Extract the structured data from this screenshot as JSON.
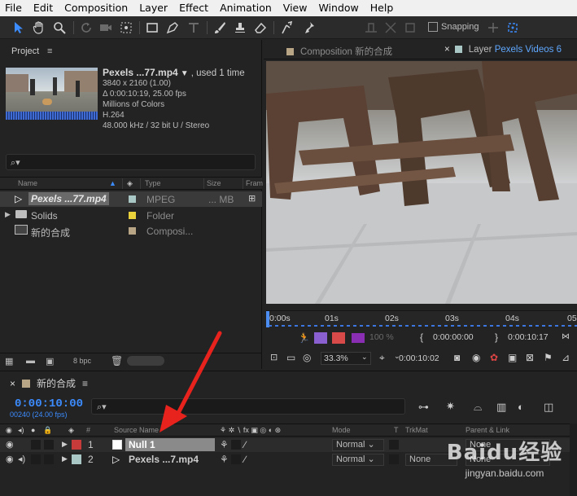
{
  "menu": [
    "File",
    "Edit",
    "Composition",
    "Layer",
    "Effect",
    "Animation",
    "View",
    "Window",
    "Help"
  ],
  "toolbar": {
    "snapping_label": "Snapping",
    "snapping_checked": false
  },
  "project": {
    "title": "Project",
    "menu_icon": "hamburger-icon",
    "file_name": "Pexels ...77.mp4",
    "used": ", used 1 time",
    "details": [
      "3840 x 2160 (1.00)",
      "Δ 0:00:10:19, 25.00 fps",
      "Millions of Colors",
      "H.264",
      "48.000 kHz / 32 bit U / Stereo"
    ],
    "search_placeholder": "",
    "columns": {
      "name": "Name",
      "type": "Type",
      "size": "Size",
      "frame": "Fram"
    },
    "items": [
      {
        "name": "Pexels ...77.mp4",
        "type": "MPEG",
        "size": "... MB",
        "label_color": "#a9c7c5",
        "icon": "footage-icon",
        "selected": true
      },
      {
        "name": "Solids",
        "type": "Folder",
        "size": "",
        "label_color": "#e8d13b",
        "icon": "folder-icon",
        "selected": false
      },
      {
        "name": "新的合成",
        "type": "Composi...",
        "size": "",
        "label_color": "#b8a586",
        "icon": "composition-icon",
        "selected": false
      }
    ],
    "bpc": "8 bpc"
  },
  "viewer": {
    "tab_composition": "Composition",
    "tab_composition_name": "新的合成",
    "tab_layer": "Layer",
    "tab_layer_name": "Pexels Videos 6",
    "ruler_ticks": [
      "0:00s",
      "01s",
      "02s",
      "03s",
      "04s",
      "05"
    ],
    "zoom_percent": "100 %",
    "in_time": "0:00:00:00",
    "out_time": "0:00:10:17",
    "zoom": "33.3%",
    "current_time": "0:00:10:02"
  },
  "timeline": {
    "tab_name": "新的合成",
    "timecode": "0:00:10:00",
    "frames": "00240 (24.00 fps)",
    "columns": {
      "num": "#",
      "source": "Source Name",
      "mode": "Mode",
      "t": "T",
      "trkmat": "TrkMat",
      "parent": "Parent & Link"
    },
    "layers": [
      {
        "index": "1",
        "name": "Null 1",
        "label_color": "#c83b3b",
        "mode": "Normal",
        "trkmat": "",
        "parent": "None"
      },
      {
        "index": "2",
        "name": "Pexels ...7.mp4",
        "label_color": "#a9c7c5",
        "mode": "Normal",
        "trkmat": "None",
        "parent": "None"
      }
    ]
  },
  "colors": {
    "accent_blue": "#3c8cff",
    "arrow_red": "#e8231e"
  },
  "watermark": {
    "logo": "Baidu经验",
    "url": "jingyan.baidu.com"
  }
}
